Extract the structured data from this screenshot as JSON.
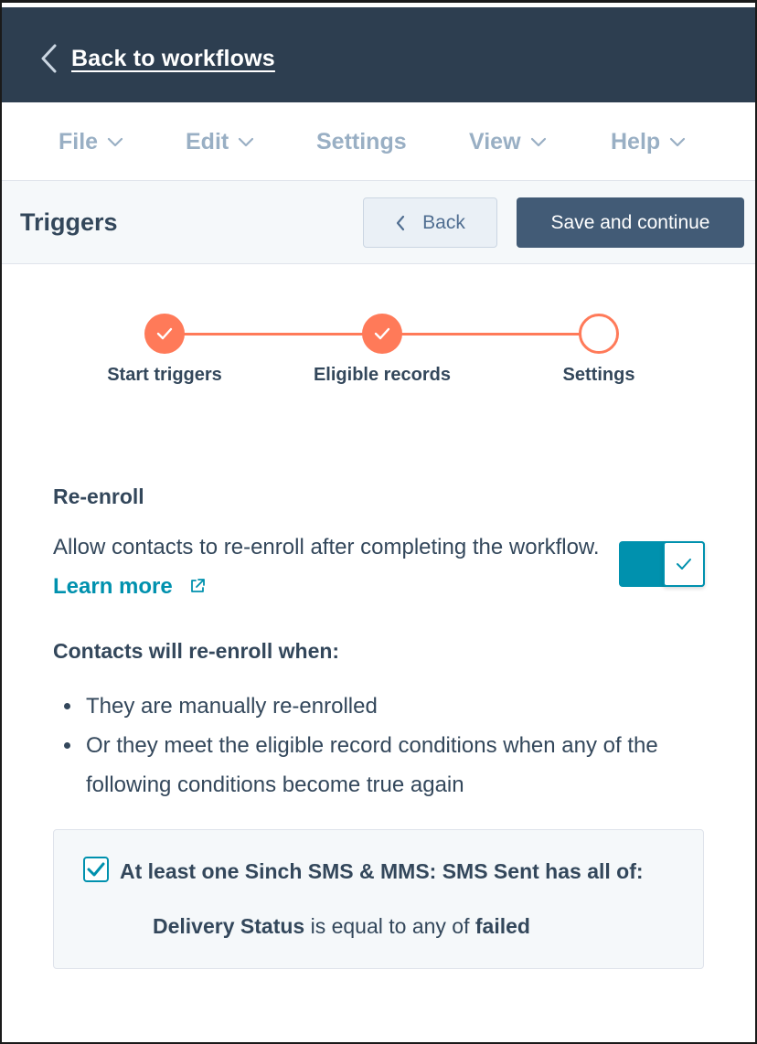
{
  "topbar": {
    "back_label": "Back to workflows"
  },
  "menu": {
    "items": [
      {
        "label": "File",
        "has_dropdown": true
      },
      {
        "label": "Edit",
        "has_dropdown": true
      },
      {
        "label": "Settings",
        "has_dropdown": false
      },
      {
        "label": "View",
        "has_dropdown": true
      },
      {
        "label": "Help",
        "has_dropdown": true
      }
    ]
  },
  "header": {
    "title": "Triggers",
    "back_button": "Back",
    "save_button": "Save and continue"
  },
  "stepper": {
    "steps": [
      {
        "label": "Start triggers",
        "status": "complete"
      },
      {
        "label": "Eligible records",
        "status": "complete"
      },
      {
        "label": "Settings",
        "status": "current"
      }
    ]
  },
  "reenroll": {
    "title": "Re-enroll",
    "description": "Allow contacts to re-enroll after completing the workflow.",
    "learn_more": "Learn more",
    "toggle_on": true
  },
  "conditions": {
    "heading": "Contacts will re-enroll when:",
    "bullets": [
      "They are manually re-enrolled",
      "Or they meet the eligible record conditions when any of the following conditions become true again"
    ],
    "box": {
      "checked": true,
      "title": "At least one Sinch SMS & MMS: SMS Sent has all of:",
      "property": "Delivery Status",
      "operator": "is equal to any of",
      "value": "failed"
    }
  },
  "colors": {
    "topbar_bg": "#2d3e50",
    "accent_orange": "#ff7a59",
    "teal": "#0091ae",
    "primary_button": "#425b76",
    "menu_text": "#99afc4"
  }
}
